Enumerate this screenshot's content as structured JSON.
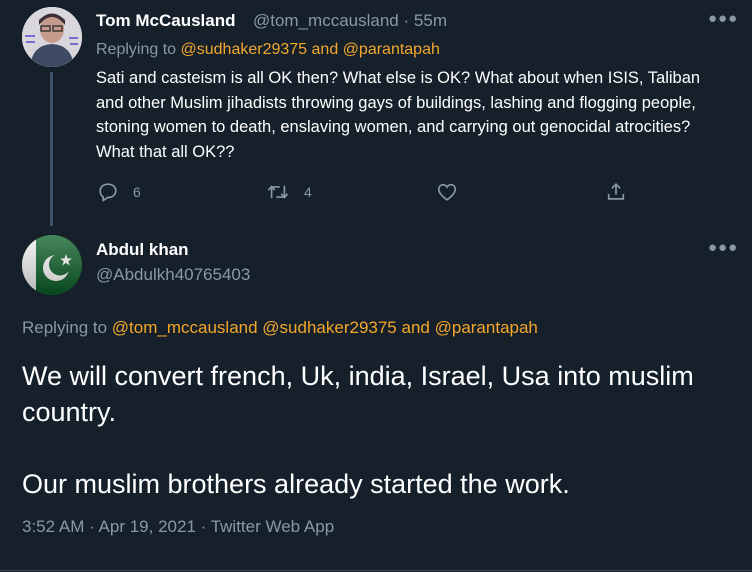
{
  "reply_tweet": {
    "author_name": "Tom McCausland",
    "author_handle": "@tom_mccausland",
    "time_sep": "·",
    "time": "55m",
    "replying_prefix": "Replying to",
    "replying_to_1": "@sudhaker29375",
    "replying_and": "and",
    "replying_to_2": "@parantapah",
    "text": "Sati and casteism is all OK then? What else is OK? What about when ISIS, Taliban and other Muslim jihadists throwing gays of buildings, lashing and flogging people, stoning women to death, enslaving women, and carrying out genocidal atrocities? What that all OK??",
    "reply_count": "6",
    "retweet_count": "4",
    "more_icon": "more-icon",
    "icons": [
      "reply-icon",
      "retweet-icon",
      "like-icon",
      "share-icon"
    ]
  },
  "main_tweet": {
    "author_name": "Abdul khan",
    "author_handle": "@Abdulkh40765403",
    "replying_prefix": "Replying to",
    "replying_to_1": "@tom_mccausland",
    "replying_to_2": "@sudhaker29375",
    "replying_and": "and",
    "replying_to_3": "@parantapah",
    "paragraph_1": "We will convert french, Uk, india, Israel, Usa into muslim country.",
    "paragraph_2": "Our muslim brothers already started the work.",
    "timestamp": "3:52 AM · Apr 19, 2021 · Twitter Web App"
  },
  "colors": {
    "background": "#15202b",
    "muted": "#8899a6",
    "mention": "#f4a72b",
    "text": "#ffffff"
  }
}
